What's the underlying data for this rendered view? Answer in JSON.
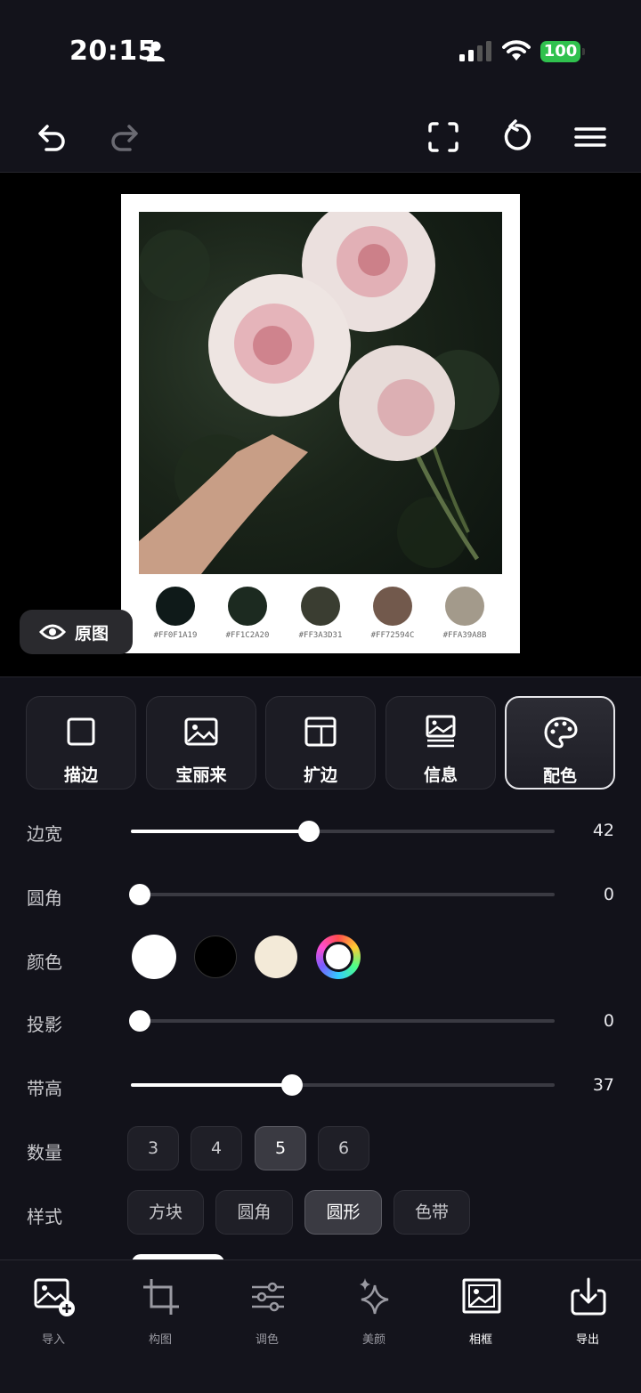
{
  "status_bar": {
    "time": "20:15",
    "battery": "100"
  },
  "canvas": {
    "original_button": "原图",
    "swatches": [
      {
        "color": "#0F1A19",
        "label": "#FF0F1A19"
      },
      {
        "color": "#1C2A20",
        "label": "#FF1C2A20"
      },
      {
        "color": "#3A3D31",
        "label": "#FF3A3D31"
      },
      {
        "color": "#72594C",
        "label": "#FF72594C"
      },
      {
        "color": "#A39A8B",
        "label": "#FFA39A8B"
      }
    ]
  },
  "tabs": [
    {
      "label": "描边",
      "icon": "square-icon"
    },
    {
      "label": "宝丽来",
      "icon": "image-icon"
    },
    {
      "label": "扩边",
      "icon": "expand-frame-icon"
    },
    {
      "label": "信息",
      "icon": "info-card-icon"
    },
    {
      "label": "配色",
      "icon": "palette-icon",
      "active": true
    }
  ],
  "settings": {
    "border_width": {
      "label": "边宽",
      "value": "42",
      "fraction": 0.42
    },
    "corner": {
      "label": "圆角",
      "value": "0",
      "fraction": 0.0
    },
    "color": {
      "label": "颜色",
      "options": [
        "#FFFFFF",
        "#000000",
        "#F3EAD8",
        "custom"
      ]
    },
    "shadow": {
      "label": "投影",
      "value": "0",
      "fraction": 0.0
    },
    "band_height": {
      "label": "带高",
      "value": "37",
      "fraction": 0.38
    },
    "count": {
      "label": "数量",
      "options": [
        "3",
        "4",
        "5",
        "6"
      ],
      "selected": "5"
    },
    "style": {
      "label": "样式",
      "options": [
        "方块",
        "圆角",
        "圆形",
        "色带"
      ],
      "selected": "圆形"
    }
  },
  "bottom_nav": [
    {
      "label": "导入",
      "icon": "import-image-icon"
    },
    {
      "label": "构图",
      "icon": "crop-icon"
    },
    {
      "label": "调色",
      "icon": "sliders-icon"
    },
    {
      "label": "美颜",
      "icon": "sparkle-icon"
    },
    {
      "label": "相框",
      "icon": "frame-icon",
      "active": true
    },
    {
      "label": "导出",
      "icon": "export-icon"
    }
  ]
}
